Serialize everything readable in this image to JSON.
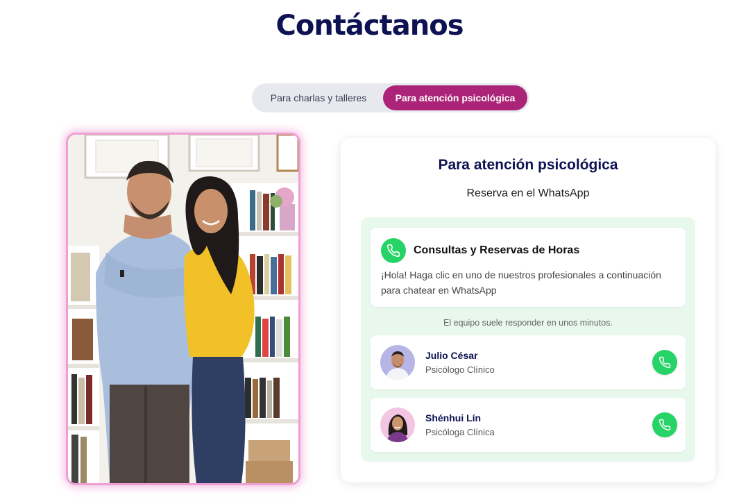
{
  "page": {
    "title": "Contáctanos"
  },
  "tabs": [
    {
      "label": "Para charlas y talleres",
      "active": false
    },
    {
      "label": "Para atención psicológica",
      "active": true
    }
  ],
  "photo": {
    "icon": "photo-of-two-psychologists"
  },
  "contact_card": {
    "title": "Para atención psicológica",
    "subtitle": "Reserva en el WhatsApp",
    "whatsapp": {
      "icon": "phone-icon",
      "heading": "Consultas y Reservas de Horas",
      "message": "¡Hola! Haga clic en uno de nuestros profesionales a continuación para chatear en WhatsApp",
      "note": "El equipo suele responder en unos minutos.",
      "agents": [
        {
          "name": "Julio César",
          "role": "Psicólogo Clínico"
        },
        {
          "name": "Shénhui Lín",
          "role": "Psicóloga Clínica"
        }
      ]
    }
  },
  "colors": {
    "title": "#0d1252",
    "accent_pink": "#ab2478",
    "whatsapp_green": "#25d366",
    "panel_green": "#e9f8ed"
  }
}
